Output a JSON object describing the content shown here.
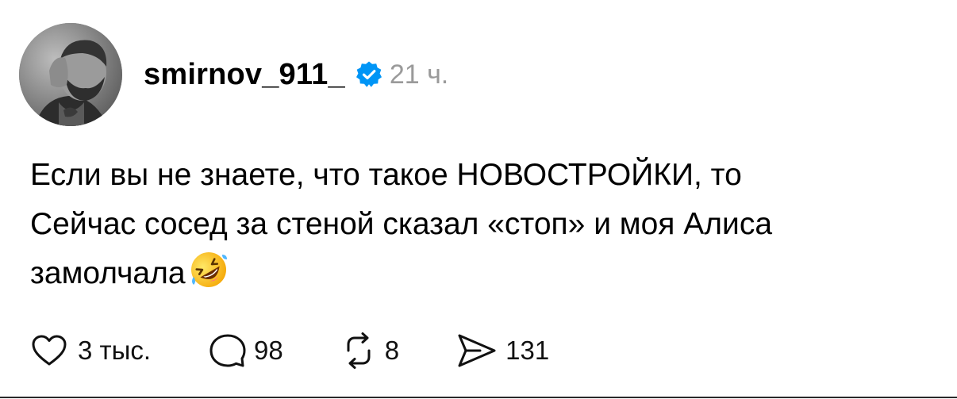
{
  "post": {
    "username": "smirnov_911_",
    "time": "21 ч.",
    "text_lines": [
      "Если вы не знаете, что такое НОВОСТРОЙКИ, то",
      "Сейчас сосед за стеной сказал «стоп» и моя Алиса",
      "замолчала"
    ],
    "emoji": "rolling-on-the-floor-laughing",
    "verified_color": "#0095f6"
  },
  "actions": {
    "likes": "3 тыс.",
    "comments": "98",
    "reposts": "8",
    "shares": "131"
  },
  "icons": {
    "like": "heart-icon",
    "comment": "comment-bubble-icon",
    "repost": "repost-icon",
    "share": "send-icon"
  }
}
